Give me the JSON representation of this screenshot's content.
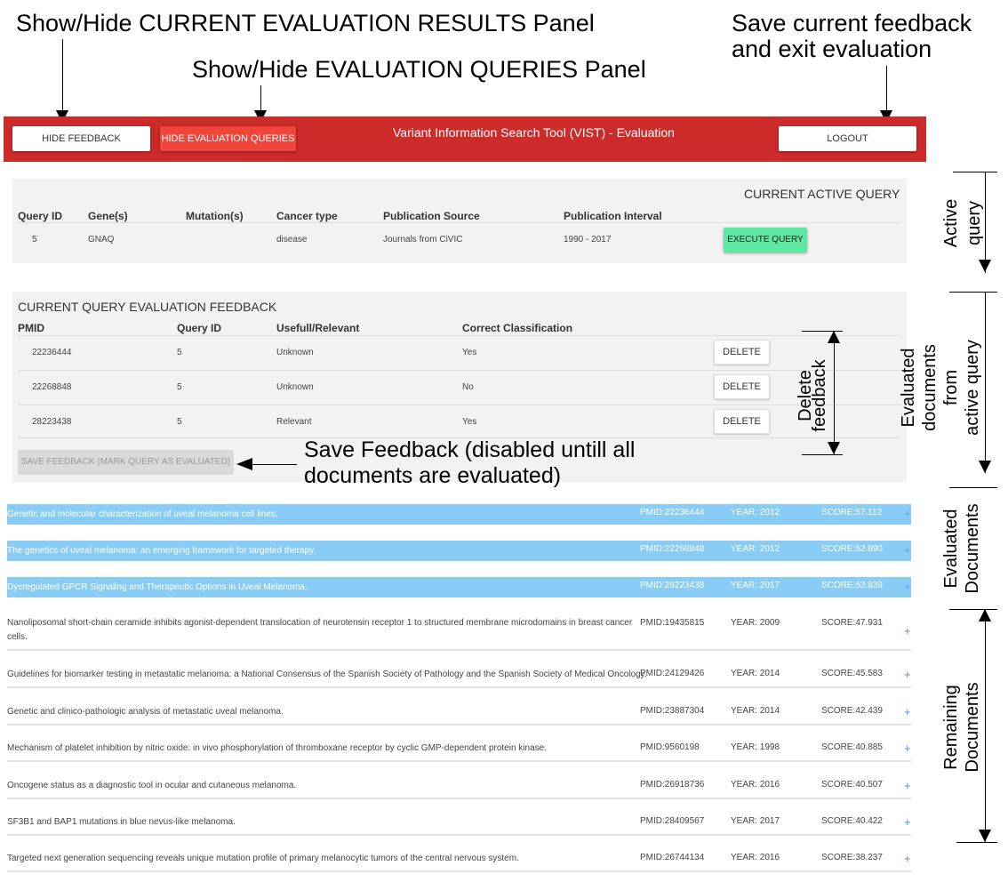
{
  "annotations": {
    "toggle_results": "Show/Hide CURRENT EVALUATION RESULTS Panel",
    "toggle_queries": "Show/Hide EVALUATION QUERIES Panel",
    "save_exit_line1": "Save current feedback",
    "save_exit_line2": "and exit evaluation",
    "save_feedback_line1": "Save Feedback (disabled untill all",
    "save_feedback_line2": "documents are evaluated)",
    "delete_feedback_line1": "Delete",
    "delete_feedback_line2": "feedback",
    "active_query_line1": "Active",
    "active_query_line2": "query",
    "evaluated_from_line1": "Evaluated",
    "evaluated_from_line2": "documents",
    "evaluated_from_line3": "from",
    "evaluated_from_line4": "active query",
    "evaluated_docs_line1": "Evaluated",
    "evaluated_docs_line2": "Documents",
    "remaining_docs_line1": "Remaining",
    "remaining_docs_line2": "Documents"
  },
  "topbar": {
    "hide_feedback": "HIDE FEEDBACK",
    "hide_queries": "HIDE EVALUATION QUERIES",
    "title": "Variant Information Search Tool (VIST) - Evaluation",
    "logout": "LOGOUT",
    "bg_color": "#cd2a2a"
  },
  "active_query": {
    "title": "CURRENT ACTIVE QUERY",
    "headers": [
      "Query ID",
      "Gene(s)",
      "Mutation(s)",
      "Cancer type",
      "Publication Source",
      "Publication Interval"
    ],
    "row": {
      "id": "5",
      "genes": "GNAQ",
      "mutations": "",
      "cancer": "disease",
      "source": "Journals from CiVIC",
      "interval": "1990 - 2017"
    },
    "execute": "EXECUTE QUERY"
  },
  "feedback": {
    "title": "CURRENT QUERY EVALUATION FEEDBACK",
    "headers": [
      "PMID",
      "Query ID",
      "Usefull/Relevant",
      "Correct Classification"
    ],
    "rows": [
      {
        "pmid": "22236444",
        "qid": "5",
        "relevant": "Unknown",
        "correct": "Yes",
        "delete": "DELETE"
      },
      {
        "pmid": "22268848",
        "qid": "5",
        "relevant": "Unknown",
        "correct": "No",
        "delete": "DELETE"
      },
      {
        "pmid": "28223438",
        "qid": "5",
        "relevant": "Relevant",
        "correct": "Yes",
        "delete": "DELETE"
      }
    ],
    "save": "SAVE FEEDBACK (MARK QUERY AS EVALUATED)"
  },
  "documents": [
    {
      "title": "Genetic and molecular characterization of uveal melanoma cell lines.",
      "pmid": "PMID:22236444",
      "year": "YEAR: 2012",
      "score": "SCORE:57.112",
      "plus": "+",
      "evaluated": true
    },
    {
      "title": "The genetics of uveal melanoma: an emerging framework for targeted therapy.",
      "pmid": "PMID:22268848",
      "year": "YEAR: 2012",
      "score": "SCORE:53.890",
      "plus": "+",
      "evaluated": true
    },
    {
      "title": "Dysregulated GPCR Signaling and Therapeutic Options in Uveal Melanoma.",
      "pmid": "PMID:28223438",
      "year": "YEAR: 2017",
      "score": "SCORE:53.839",
      "plus": "+",
      "evaluated": true
    },
    {
      "title": "Nanoliposomal short-chain ceramide inhibits agonist-dependent translocation of neurotensin receptor 1 to structured membrane microdomains in breast cancer cells.",
      "pmid": "PMID:19435815",
      "year": "YEAR: 2009",
      "score": "SCORE:47.931",
      "plus": "+",
      "evaluated": false
    },
    {
      "title": "Guidelines for biomarker testing in metastatic melanoma: a National Consensus of the Spanish Society of Pathology and the Spanish Society of Medical Oncology.",
      "pmid": "PMID:24129426",
      "year": "YEAR: 2014",
      "score": "SCORE:45.583",
      "plus": "+",
      "evaluated": false
    },
    {
      "title": "Genetic and clinico-pathologic analysis of metastatic uveal melanoma.",
      "pmid": "PMID:23887304",
      "year": "YEAR: 2014",
      "score": "SCORE:42.439",
      "plus": "+",
      "evaluated": false
    },
    {
      "title": "Mechanism of platelet inhibition by nitric oxide: in vivo phosphorylation of thromboxane receptor by cyclic GMP-dependent protein kinase.",
      "pmid": "PMID:9560198",
      "year": "YEAR: 1998",
      "score": "SCORE:40.885",
      "plus": "+",
      "evaluated": false
    },
    {
      "title": "Oncogene status as a diagnostic tool in ocular and cutaneous melanoma.",
      "pmid": "PMID:26918736",
      "year": "YEAR: 2016",
      "score": "SCORE:40.507",
      "plus": "+",
      "evaluated": false
    },
    {
      "title": "SF3B1 and BAP1 mutations in blue nevus-like melanoma.",
      "pmid": "PMID:28409567",
      "year": "YEAR: 2017",
      "score": "SCORE:40.422",
      "plus": "+",
      "evaluated": false
    },
    {
      "title": "Targeted next generation sequencing reveals unique mutation profile of primary melanocytic tumors of the central nervous system.",
      "pmid": "PMID:26744134",
      "year": "YEAR: 2016",
      "score": "SCORE:38.237",
      "plus": "+",
      "evaluated": false
    }
  ]
}
